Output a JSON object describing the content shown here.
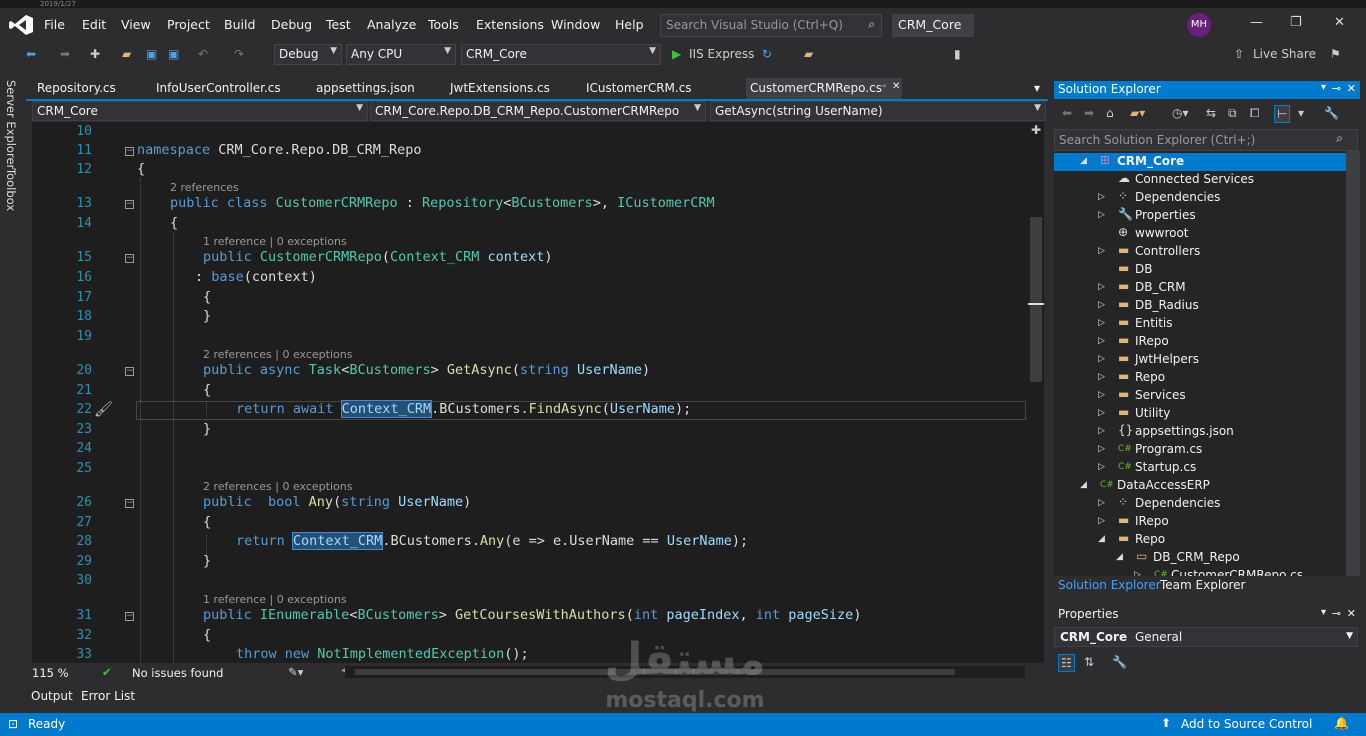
{
  "title_strip": "2019/1/27",
  "menu": [
    "File",
    "Edit",
    "View",
    "Project",
    "Build",
    "Debug",
    "Test",
    "Analyze",
    "Tools",
    "Extensions",
    "Window",
    "Help"
  ],
  "search": {
    "placeholder": "Search Visual Studio (Ctrl+Q)"
  },
  "solution_name": "CRM_Core",
  "avatar_initials": "MH",
  "toolbar": {
    "config": "Debug",
    "platform": "Any CPU",
    "startup": "CRM_Core",
    "run_label": "IIS Express",
    "live_share": "Live Share"
  },
  "sidebar_tabs": [
    "Server Explorer",
    "Toolbox"
  ],
  "tabs": [
    "Repository.cs",
    "InfoUserController.cs",
    "appsettings.json",
    "JwtExtensions.cs",
    "ICustomerCRM.cs",
    "CustomerCRMRepo.cs"
  ],
  "nav": {
    "project": "CRM_Core",
    "type": "CRM_Core.Repo.DB_CRM_Repo.CustomerCRMRepo",
    "member": "GetAsync(string UserName)"
  },
  "line_numbers": [
    "10",
    "11",
    "12",
    "13",
    "14",
    "15",
    "16",
    "17",
    "18",
    "19",
    "20",
    "21",
    "22",
    "23",
    "24",
    "25",
    "26",
    "27",
    "28",
    "29",
    "30",
    "31",
    "32",
    "33"
  ],
  "codelens": {
    "c13": "2 references",
    "c15": "1 reference | 0 exceptions",
    "c20": "2 references | 0 exceptions",
    "c26": "2 references | 0 exceptions",
    "c31": "1 reference | 0 exceptions"
  },
  "code": {
    "l11_kw": "namespace",
    "l11_rest": " CRM_Core.Repo.DB_CRM_Repo",
    "brace_open": "{",
    "brace_close": "}",
    "l13_kw": "public class ",
    "l13_name": "CustomerCRMRepo",
    "l13_colon": " : ",
    "l13_repo": "Repository",
    "l13_lt": "<",
    "l13_bc": "BCustomers",
    "l13_gt": ">, ",
    "l13_icrm": "ICustomerCRM",
    "l15_kw": "public ",
    "l15_name": "CustomerCRMRepo",
    "l15_p": "(",
    "l15_ctx": "Context_CRM",
    "l15_arg": " context",
    "l15_end": ")",
    "l16_colon": ": ",
    "l16_base": "base",
    "l16_rest": "(context)",
    "l20_kw": "public async ",
    "l20_task": "Task",
    "l20_lt": "<",
    "l20_bc": "BCustomers",
    "l20_gt": "> ",
    "l20_fn": "GetAsync",
    "l20_p": "(",
    "l20_str": "string ",
    "l20_un": "UserName",
    "l20_end": ")",
    "l22_kw": "return await ",
    "l22_ctx": "Context_CRM",
    "l22_mid": ".BCustomers.",
    "l22_fn": "FindAsync",
    "l22_p": "(",
    "l22_un": "UserName",
    "l22_end": ");",
    "l26_kw": "public  bool ",
    "l26_fn": "Any",
    "l26_p": "(",
    "l26_str": "string ",
    "l26_un": "UserName",
    "l26_end": ")",
    "l28_kw": "return ",
    "l28_ctx": "Context_CRM",
    "l28_mid": ".BCustomers.",
    "l28_fn": "Any",
    "l28_rest": "(e => e.UserName == ",
    "l28_un": "UserName",
    "l28_end": ");",
    "l31_kw": "public ",
    "l31_ie": "IEnumerable",
    "l31_lt": "<",
    "l31_bc": "BCustomers",
    "l31_gt": "> ",
    "l31_fn": "GetCoursesWithAuthors",
    "l31_p": "(",
    "l31_int": "int ",
    "l31_pi": "pageIndex",
    "l31_c": ", ",
    "l31_int2": "int ",
    "l31_ps": "pageSize",
    "l31_end": ")",
    "l33_kw": "throw new ",
    "l33_ex": "NotImplementedException",
    "l33_end": "();"
  },
  "editor_status": {
    "zoom": "115 %",
    "issues": "No issues found"
  },
  "output_tabs": [
    "Output",
    "Error List"
  ],
  "statusbar": {
    "ready": "Ready",
    "source_control": "Add to Source Control"
  },
  "solution_explorer": {
    "title": "Solution Explorer",
    "search_placeholder": "Search Solution Explorer (Ctrl+;)",
    "tree": [
      {
        "label": "CRM_Core",
        "icon": "⊞",
        "exp": "◢"
      },
      {
        "label": "Connected Services",
        "icon": "☁",
        "exp": ""
      },
      {
        "label": "Dependencies",
        "icon": "⁘",
        "exp": "▷"
      },
      {
        "label": "Properties",
        "icon": "🔧",
        "exp": "▷"
      },
      {
        "label": "wwwroot",
        "icon": "⊕",
        "exp": ""
      },
      {
        "label": "Controllers",
        "icon": "▬",
        "exp": "▷"
      },
      {
        "label": "DB",
        "icon": "▬",
        "exp": ""
      },
      {
        "label": "DB_CRM",
        "icon": "▬",
        "exp": "▷"
      },
      {
        "label": "DB_Radius",
        "icon": "▬",
        "exp": "▷"
      },
      {
        "label": "Entitis",
        "icon": "▬",
        "exp": "▷"
      },
      {
        "label": "IRepo",
        "icon": "▬",
        "exp": "▷"
      },
      {
        "label": "JwtHelpers",
        "icon": "▬",
        "exp": "▷"
      },
      {
        "label": "Repo",
        "icon": "▬",
        "exp": "▷"
      },
      {
        "label": "Services",
        "icon": "▬",
        "exp": "▷"
      },
      {
        "label": "Utility",
        "icon": "▬",
        "exp": "▷"
      },
      {
        "label": "appsettings.json",
        "icon": "{}",
        "exp": "▷"
      },
      {
        "label": "Program.cs",
        "icon": "C#",
        "exp": "▷"
      },
      {
        "label": "Startup.cs",
        "icon": "C#",
        "exp": "▷"
      },
      {
        "label": "DataAccessERP",
        "icon": "C#",
        "exp": "◢"
      },
      {
        "label": "Dependencies",
        "icon": "⁘",
        "exp": "▷"
      },
      {
        "label": "IRepo",
        "icon": "▬",
        "exp": "▷"
      },
      {
        "label": "Repo",
        "icon": "▬",
        "exp": "◢"
      },
      {
        "label": "DB_CRM_Repo",
        "icon": "▭",
        "exp": "◢"
      },
      {
        "label": "CustomerCRMRepo.cs",
        "icon": "C#",
        "exp": "▷"
      }
    ],
    "bottom_tabs": [
      "Solution Explorer",
      "Team Explorer"
    ]
  },
  "properties": {
    "title": "Properties",
    "object": "CRM_Core",
    "object_type": "General"
  },
  "watermark": {
    "arabic": "مستقل",
    "latin": "mostaql.com"
  },
  "colors": {
    "accent": "#007acc",
    "keyword": "#569cd6",
    "type": "#4ec9b0",
    "method": "#dcdcaa",
    "param": "#9cdcfe"
  }
}
